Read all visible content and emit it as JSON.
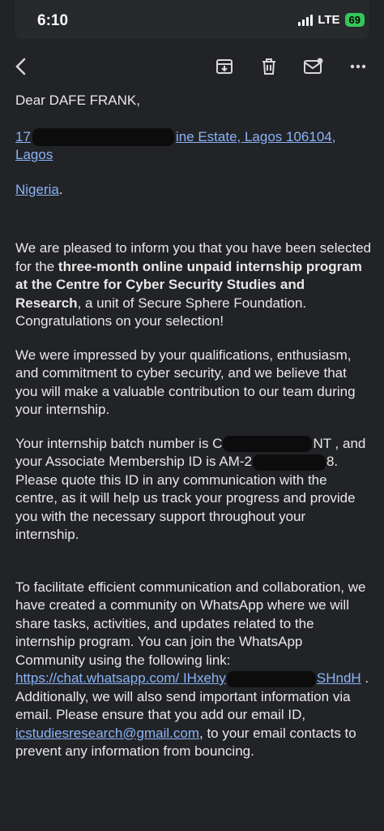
{
  "status": {
    "time": "6:10",
    "network": "LTE",
    "battery": "69"
  },
  "toolbar": {
    "icons": [
      "back-icon",
      "archive-icon",
      "delete-icon",
      "mark-unread-icon",
      "more-icon"
    ]
  },
  "email": {
    "greeting": "Dear DAFE FRANK,",
    "address_a": "17",
    "address_b": "ine Estate, Lagos 106104,",
    "address_c": "Lagos",
    "country": "Nigeria",
    "country_after": ".",
    "p1_a": "We are pleased to inform you that you have been selected for the ",
    "p1_bold": "three-month online unpaid internship program at the Centre for Cyber Security Studies and Research",
    "p1_b": ", a unit of Secure Sphere Foundation. Congratulations on your selection!",
    "p2": "We were impressed by your qualifications, enthusiasm, and commitment to cyber security, and we believe that you will make a valuable contribution to our team during your internship.",
    "p3_a": "Your internship batch number is C",
    "p3_b": "NT , and your Associate Membership ID is AM-2",
    "p3_c": "8. Please quote this ID in any communication with the centre, as it will help us track your progress and provide you with the necessary support throughout your internship.",
    "p4_a": "To facilitate efficient communication and collaboration, we have created a community on WhatsApp where we will share tasks, activities, and updates related to the internship program. You can join the WhatsApp Community using the following link: ",
    "p4_link_a": "https://chat.whatsapp.com/",
    "p4_link_b": "IHxehy",
    "p4_link_c": "SHndH",
    "p4_b": " . Additionally, we will also send important information via email. Please ensure that you add our email ID, ",
    "p4_email": "icstudiesresearch@gmail.com",
    "p4_c": ", to your email contacts to prevent any information from bouncing."
  }
}
